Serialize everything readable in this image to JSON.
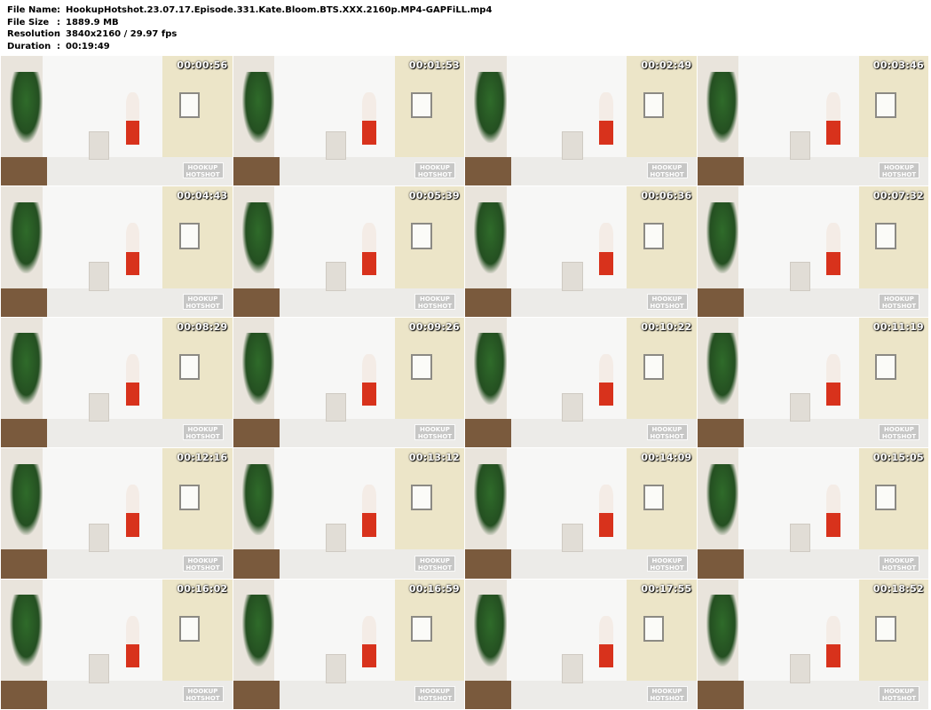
{
  "file_info": [
    {
      "label": "File Name",
      "value": "HookupHotshot.23.07.17.Episode.331.Kate.Bloom.BTS.XXX.2160p.MP4-GAPFiLL.mp4"
    },
    {
      "label": "File Size",
      "value": "1889.9 MB"
    },
    {
      "label": "Resolution",
      "value": "3840x2160 / 29.97 fps"
    },
    {
      "label": "Duration",
      "value": "00:19:49"
    }
  ],
  "separator": ":",
  "watermark": {
    "line1": "HOOKUP",
    "line2": "HOTSHOT"
  },
  "thumbnails": [
    {
      "timestamp": "00:00:56"
    },
    {
      "timestamp": "00:01:53"
    },
    {
      "timestamp": "00:02:49"
    },
    {
      "timestamp": "00:03:46"
    },
    {
      "timestamp": "00:04:43"
    },
    {
      "timestamp": "00:05:39"
    },
    {
      "timestamp": "00:06:36"
    },
    {
      "timestamp": "00:07:32"
    },
    {
      "timestamp": "00:08:29"
    },
    {
      "timestamp": "00:09:26"
    },
    {
      "timestamp": "00:10:22"
    },
    {
      "timestamp": "00:11:19"
    },
    {
      "timestamp": "00:12:16"
    },
    {
      "timestamp": "00:13:12"
    },
    {
      "timestamp": "00:14:09"
    },
    {
      "timestamp": "00:15:05"
    },
    {
      "timestamp": "00:16:02"
    },
    {
      "timestamp": "00:16:59"
    },
    {
      "timestamp": "00:17:55"
    },
    {
      "timestamp": "00:18:52"
    }
  ]
}
